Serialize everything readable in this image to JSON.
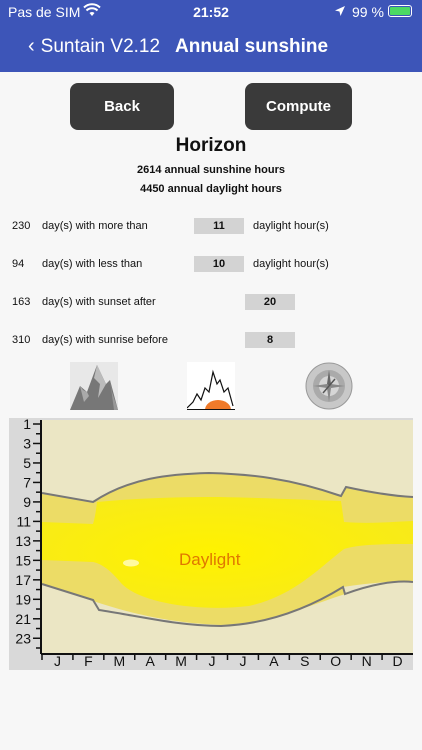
{
  "status": {
    "carrier": "Pas de SIM",
    "time": "21:52",
    "battery": "99 %"
  },
  "nav": {
    "back_label": "Suntain  V2.12",
    "title": "Annual sunshine"
  },
  "buttons": {
    "back": "Back",
    "compute": "Compute"
  },
  "heading": "Horizon",
  "stats": {
    "sunshine": "2614 annual sunshine hours",
    "daylight": "4450 annual daylight hours"
  },
  "rows": [
    {
      "num": "230",
      "desc": "day(s) with more than",
      "value": "11",
      "unit": "daylight hour(s)"
    },
    {
      "num": "94",
      "desc": "day(s) with less than",
      "value": "10",
      "unit": "daylight hour(s)"
    },
    {
      "num": "163",
      "desc": "day(s) with sunset after",
      "value": "20",
      "unit": ""
    },
    {
      "num": "310",
      "desc": "day(s) with sunrise before",
      "value": "8",
      "unit": ""
    }
  ],
  "icons": [
    "mountain-icon",
    "horizon-sun-icon",
    "compass-icon"
  ],
  "colors": {
    "nav": "#3d55b8",
    "daylight": "#f7ec00",
    "twilight": "#ecdc60",
    "night": "#ede9c6",
    "label": "#e07800"
  },
  "chart_data": {
    "type": "area",
    "categories": [
      "J",
      "F",
      "M",
      "A",
      "M",
      "J",
      "J",
      "A",
      "S",
      "O",
      "N",
      "D"
    ],
    "y_ticks": [
      "1",
      "3",
      "5",
      "7",
      "9",
      "11",
      "13",
      "15",
      "17",
      "19",
      "21",
      "23"
    ],
    "ylim": [
      0,
      24
    ],
    "label": "Daylight"
  }
}
